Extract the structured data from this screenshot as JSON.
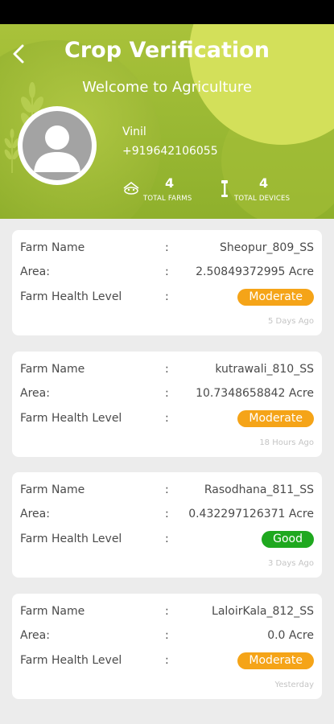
{
  "header": {
    "title": "Crop Verification",
    "subtitle": "Welcome to Agriculture"
  },
  "user": {
    "name": "Vinil",
    "phone": "+919642106055"
  },
  "stats": {
    "farms": {
      "count": "4",
      "label": "TOTAL FARMS",
      "icon": "farm-icon"
    },
    "devices": {
      "count": "4",
      "label": "TOTAL DEVICES",
      "icon": "device-icon"
    }
  },
  "labels": {
    "farm_name": "Farm Name",
    "area": "Area:",
    "health": "Farm Health Level",
    "separator": ":"
  },
  "farms": [
    {
      "name": "Sheopur_809_SS",
      "area": "2.50849372995 Acre",
      "health": "Moderate",
      "health_color": "#f5a418",
      "time": "5 Days Ago"
    },
    {
      "name": "kutrawali_810_SS",
      "area": "10.7348658842 Acre",
      "health": "Moderate",
      "health_color": "#f5a418",
      "time": "18 Hours Ago"
    },
    {
      "name": "Rasodhana_811_SS",
      "area": "0.432297126371 Acre",
      "health": "Good",
      "health_color": "#1fa81f",
      "time": "3 Days Ago"
    },
    {
      "name": "LaloirKala_812_SS",
      "area": "0.0 Acre",
      "health": "Moderate",
      "health_color": "#f5a418",
      "time": "Yesterday"
    }
  ],
  "colors": {
    "header_green": "#9bb935",
    "moderate": "#f5a418",
    "good": "#1fa81f"
  }
}
